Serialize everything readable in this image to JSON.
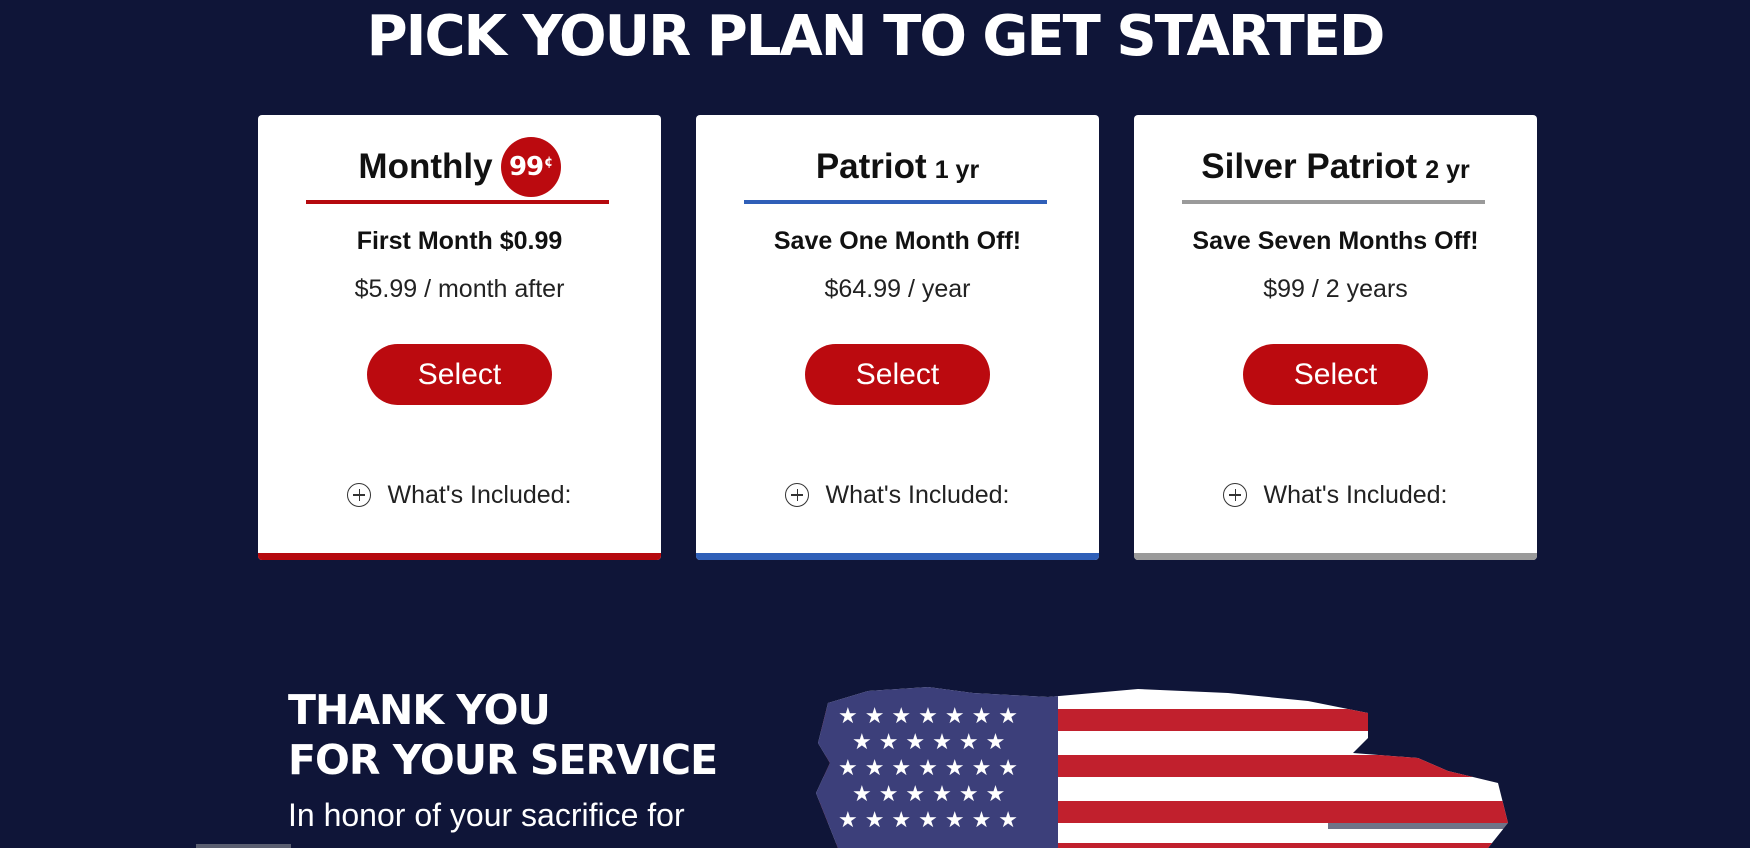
{
  "page_title": "PICK YOUR PLAN TO GET STARTED",
  "plans": [
    {
      "name": "Monthly",
      "badge_value": "99",
      "badge_unit": "¢",
      "term": "",
      "promo": "First Month $0.99",
      "price": "$5.99 / month after",
      "select_label": "Select",
      "included_label": "What's Included:",
      "accent_color": "#b5090e",
      "icon": "plus-circle-icon"
    },
    {
      "name": "Patriot",
      "term": "1 yr",
      "promo": "Save One Month Off!",
      "price": "$64.99 / year",
      "select_label": "Select",
      "included_label": "What's Included:",
      "accent_color": "#2f5fb8",
      "icon": "plus-circle-icon"
    },
    {
      "name": "Silver Patriot",
      "term": "2 yr",
      "promo": "Save Seven Months Off!",
      "price": "$99 / 2 years",
      "select_label": "Select",
      "included_label": "What's Included:",
      "accent_color": "#9a9a9a",
      "icon": "plus-circle-icon"
    }
  ],
  "thanks": {
    "heading_line1": "THANK YOU",
    "heading_line2": "FOR YOUR SERVICE",
    "body": "In honor of your sacrifice for"
  },
  "colors": {
    "background": "#0f1538",
    "button": "#bb0a0f",
    "flag_red": "#c1202d",
    "flag_blue": "#3c3f7a",
    "white": "#ffffff"
  }
}
